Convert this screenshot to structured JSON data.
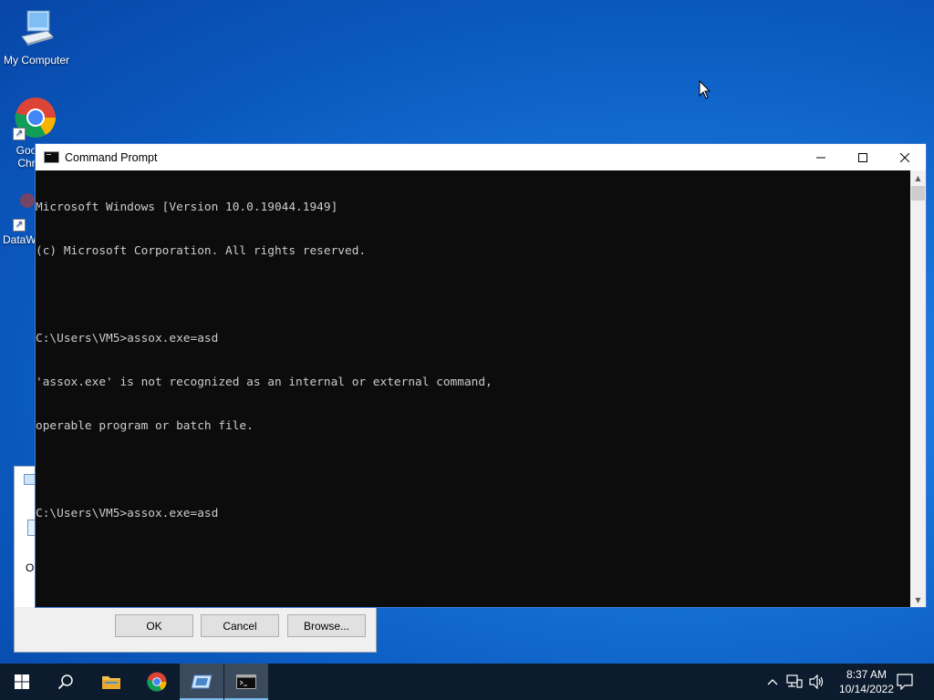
{
  "desktop": {
    "icons": [
      {
        "label": "My Computer"
      },
      {
        "label": "Goo Chr"
      },
      {
        "label": "DataW"
      }
    ],
    "cursor": "arrow-cursor"
  },
  "run_dialog": {
    "partial_label": "O",
    "ok_label": "OK",
    "cancel_label": "Cancel",
    "browse_label": "Browse..."
  },
  "cmd_window": {
    "title": "Command Prompt",
    "lines": [
      "Microsoft Windows [Version 10.0.19044.1949]",
      "(c) Microsoft Corporation. All rights reserved.",
      "",
      "C:\\Users\\VM5>assox.exe=asd",
      "'assox.exe' is not recognized as an internal or external command,",
      "operable program or batch file.",
      "",
      "C:\\Users\\VM5>assox.exe=asd"
    ],
    "controls": {
      "minimize": "minimize-icon",
      "maximize": "maximize-icon",
      "close": "close-icon"
    }
  },
  "taskbar": {
    "time": "8:37 AM",
    "date": "10/14/2022",
    "items": [
      "start",
      "search",
      "file-explorer",
      "chrome",
      "run",
      "command-prompt"
    ]
  },
  "colors": {
    "accent": "#3a7ad6",
    "console_bg": "#0c0c0c",
    "console_text": "#cccccc",
    "taskbar_bg": "#0c1b2e"
  }
}
